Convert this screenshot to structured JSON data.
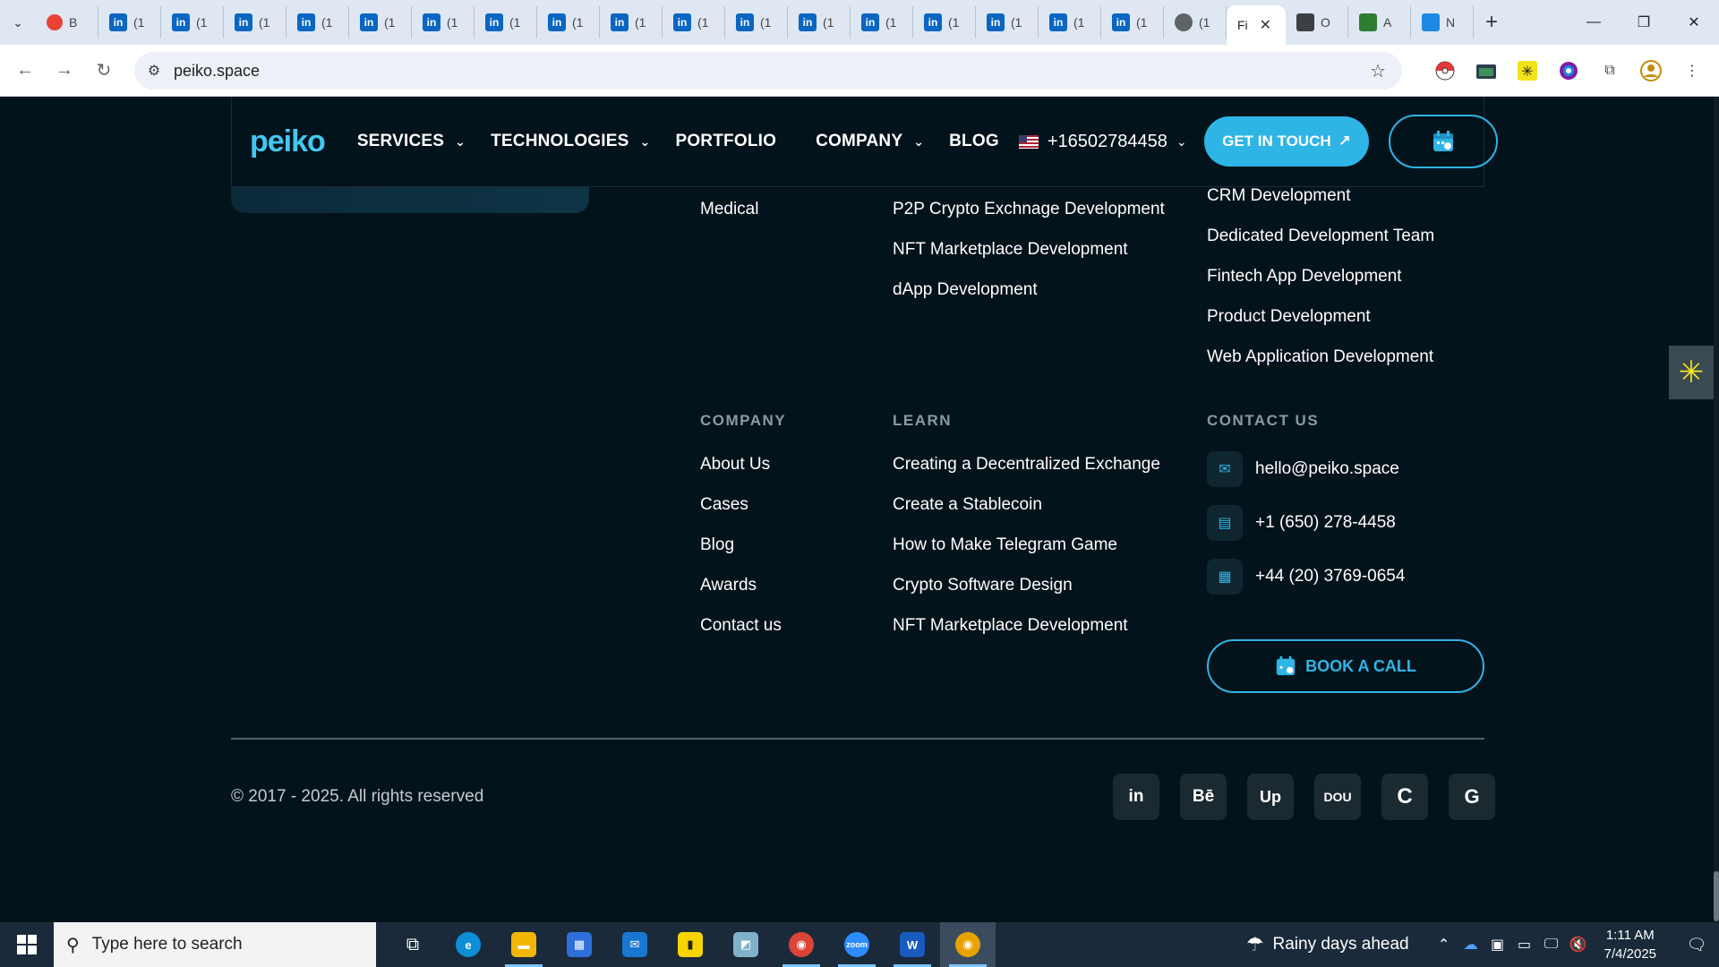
{
  "browser": {
    "tabs": [
      {
        "label": "B",
        "fav": "red"
      },
      {
        "label": "(1",
        "fav": "li"
      },
      {
        "label": "(1",
        "fav": "li"
      },
      {
        "label": "(1",
        "fav": "li"
      },
      {
        "label": "(1",
        "fav": "li"
      },
      {
        "label": "(1",
        "fav": "li"
      },
      {
        "label": "(1",
        "fav": "li"
      },
      {
        "label": "(1",
        "fav": "li"
      },
      {
        "label": "(1",
        "fav": "li"
      },
      {
        "label": "(1",
        "fav": "li"
      },
      {
        "label": "(1",
        "fav": "li"
      },
      {
        "label": "(1",
        "fav": "li"
      },
      {
        "label": "(1",
        "fav": "li"
      },
      {
        "label": "(1",
        "fav": "li"
      },
      {
        "label": "(1",
        "fav": "li"
      },
      {
        "label": "(1",
        "fav": "li"
      },
      {
        "label": "(1",
        "fav": "li"
      },
      {
        "label": "(1",
        "fav": "li"
      },
      {
        "label": "(1",
        "fav": "gray"
      }
    ],
    "active_tab_label": "Fi",
    "after_tabs": [
      {
        "label": "O",
        "fav": "dark"
      },
      {
        "label": "A",
        "fav": "green"
      },
      {
        "label": "N",
        "fav": "blue2"
      }
    ],
    "url": "peiko.space"
  },
  "header": {
    "logo": "peiko",
    "menu": [
      {
        "label": "SERVICES",
        "dropdown": true
      },
      {
        "label": "TECHNOLOGIES",
        "dropdown": true
      },
      {
        "label": "PORTFOLIO",
        "dropdown": false
      },
      {
        "label": "COMPANY",
        "dropdown": true
      },
      {
        "label": "BLOG",
        "dropdown": false
      }
    ],
    "phone": "+16502784458",
    "cta": "GET IN TOUCH",
    "cta_arrow": "↗"
  },
  "footer": {
    "industries_tail": [
      "Medical"
    ],
    "blockchain_tail": [
      "P2P Crypto Exchnage Development",
      "NFT Marketplace Development",
      "dApp Development"
    ],
    "services_tail": [
      "CRM Development",
      "Dedicated Development Team",
      "Fintech App Development",
      "Product Development",
      "Web Application Development"
    ],
    "company": {
      "heading": "COMPANY",
      "links": [
        "About Us",
        "Cases",
        "Blog",
        "Awards",
        "Contact us"
      ]
    },
    "learn": {
      "heading": "LEARN",
      "links": [
        "Creating a Decentralized Exchange",
        "Create a Stablecoin",
        "How to Make Telegram Game",
        "Crypto Software Design",
        "NFT Marketplace Development"
      ]
    },
    "contact": {
      "heading": "CONTACT US",
      "email": "hello@peiko.space",
      "phone_us": "+1 (650) 278-4458",
      "phone_uk": "+44 (20) 3769-0654",
      "book_call": "BOOK A CALL"
    },
    "copyright": "© 2017 - 2025. All rights reserved",
    "socials": [
      {
        "name": "linkedin",
        "glyph": "in"
      },
      {
        "name": "behance",
        "glyph": "Bē"
      },
      {
        "name": "upwork",
        "glyph": "Up"
      },
      {
        "name": "dou",
        "glyph": "DOU"
      },
      {
        "name": "clutch",
        "glyph": "C"
      },
      {
        "name": "goodfirms",
        "glyph": "G"
      }
    ]
  },
  "taskbar": {
    "search_placeholder": "Type here to search",
    "weather": "Rainy days ahead",
    "time": "1:11 AM",
    "date": "7/4/2025"
  },
  "colors": {
    "page_bg": "#03131b",
    "accent": "#2fb4e6",
    "heading_gray": "#8a9aa3"
  }
}
